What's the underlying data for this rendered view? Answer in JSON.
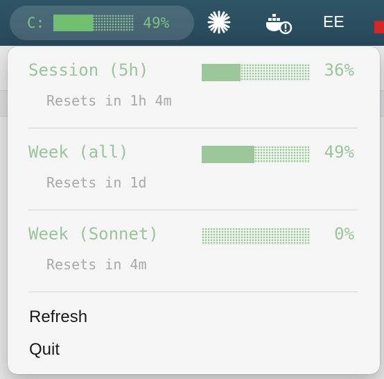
{
  "menubar": {
    "claude": {
      "label": "C:",
      "percent_text": "49%",
      "fraction": 0.49
    },
    "icons": [
      "sparkle-icon",
      "docker-icon"
    ],
    "text_item": "EE"
  },
  "menu": {
    "rows": [
      {
        "name": "Session (5h)",
        "percent_text": "36%",
        "fraction": 0.36,
        "reset": "Resets in 1h 4m"
      },
      {
        "name": "Week (all)",
        "percent_text": "49%",
        "fraction": 0.49,
        "reset": "Resets in 1d"
      },
      {
        "name": "Week (Sonnet)",
        "percent_text": "0%",
        "fraction": 0.0,
        "reset": "Resets in 4m"
      }
    ],
    "actions": {
      "refresh": "Refresh",
      "quit": "Quit"
    }
  },
  "colors": {
    "accent": "#9cc49c",
    "bar_fill": "#9bc79b",
    "menubar_bg": "#2b5062"
  }
}
